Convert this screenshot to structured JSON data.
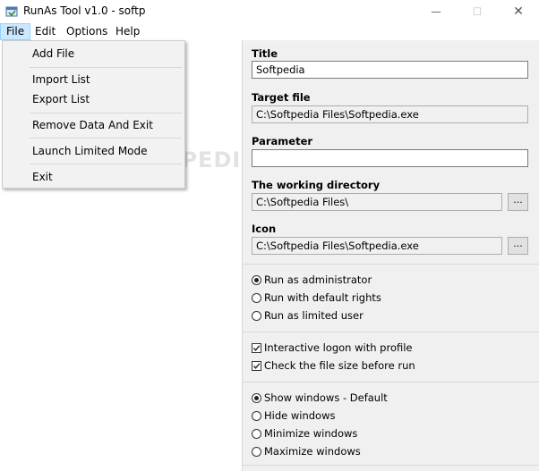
{
  "window": {
    "title": "RunAs Tool v1.0 - softp",
    "min_glyph": "—",
    "max_glyph": "☐",
    "close_glyph": "✕"
  },
  "menu": [
    "File",
    "Edit",
    "Options",
    "Help"
  ],
  "file_menu": {
    "groups": [
      [
        "Add File"
      ],
      [
        "Import List",
        "Export List"
      ],
      [
        "Remove Data And Exit"
      ],
      [
        "Launch Limited Mode"
      ],
      [
        "Exit"
      ]
    ]
  },
  "watermark": "SOFTPEDIA",
  "form": {
    "title_label": "Title",
    "title_value": "Softpedia",
    "target_label": "Target file",
    "target_value": "C:\\Softpedia Files\\Softpedia.exe",
    "parameter_label": "Parameter",
    "parameter_value": "",
    "workdir_label": "The working directory",
    "workdir_value": "C:\\Softpedia Files\\",
    "icon_label": "Icon",
    "icon_value": "C:\\Softpedia Files\\Softpedia.exe",
    "browse_label": "..."
  },
  "rights_options": [
    {
      "label": "Run as administrator",
      "selected": true
    },
    {
      "label": "Run with default rights",
      "selected": false
    },
    {
      "label": "Run as limited user",
      "selected": false
    }
  ],
  "checks": [
    {
      "label": "Interactive logon with profile",
      "checked": true
    },
    {
      "label": "Check the file size before run",
      "checked": true
    }
  ],
  "window_options": [
    {
      "label": "Show windows - Default",
      "selected": true
    },
    {
      "label": "Hide windows",
      "selected": false
    },
    {
      "label": "Minimize windows",
      "selected": false
    },
    {
      "label": "Maximize windows",
      "selected": false
    }
  ]
}
